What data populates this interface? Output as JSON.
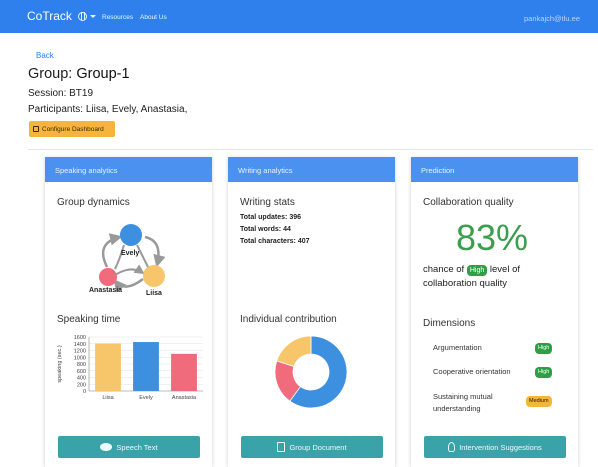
{
  "app": {
    "brand": "CoTrack",
    "nav": {
      "resources": "Resources",
      "about": "About Us"
    },
    "user": "pankajch@tlu.ee"
  },
  "page": {
    "back": "Back",
    "group_prefix": "Group: ",
    "group_name": "Group-1",
    "session_prefix": "Session: ",
    "session": "BT19",
    "participants_prefix": "Participants: ",
    "participants": "Liisa, Evely, Anastasia,",
    "configure": "Configure Dashboard"
  },
  "speaking": {
    "header": "Speaking analytics",
    "group_dynamics": "Group dynamics",
    "nodes": [
      {
        "name": "Evely",
        "color": "#3d8fe0"
      },
      {
        "name": "Anastasia",
        "color": "#f06b7b"
      },
      {
        "name": "Liisa",
        "color": "#f7c56a"
      }
    ],
    "speaking_time": "Speaking time",
    "button": "Speech Text"
  },
  "writing": {
    "header": "Writing analytics",
    "stats_title": "Writing stats",
    "updates_label": "Total updates:",
    "updates": "396",
    "words_label": "Total words:",
    "words": "44",
    "chars_label": "Total characters:",
    "chars": "407",
    "contribution": "Individual contribution",
    "button": "Group Document"
  },
  "prediction": {
    "header": "Prediction",
    "title": "Collaboration quality",
    "percent": "83%",
    "chance_pre": "chance of",
    "level": "High",
    "chance_post": "level of",
    "chance_line2": "collaboration quality",
    "dimensions_title": "Dimensions",
    "dimensions": [
      {
        "label": "Argumentation",
        "level": "High"
      },
      {
        "label": "Cooperative orientation",
        "level": "High"
      },
      {
        "label": "Sustaining mutual",
        "label2": "understanding",
        "level": "Medium"
      }
    ],
    "button": "Intervention Suggestions"
  },
  "chart_data": [
    {
      "type": "bar",
      "categories": [
        "Liisa",
        "Evely",
        "Anastasia"
      ],
      "values": [
        1410,
        1450,
        1100
      ],
      "colors": [
        "#f7c56a",
        "#3d8fe0",
        "#f06b7b"
      ],
      "ylabel": "speaking (sec.)",
      "ylim": [
        0,
        1600
      ],
      "yticks": [
        "0",
        "200",
        "400",
        "600",
        "800",
        "1000",
        "1200",
        "1400",
        "1600"
      ],
      "grid": true
    },
    {
      "type": "pie",
      "donut": true,
      "values": [
        60,
        20,
        20
      ],
      "colors": [
        "#3d8fe0",
        "#f06b7b",
        "#f7c56a"
      ]
    }
  ]
}
